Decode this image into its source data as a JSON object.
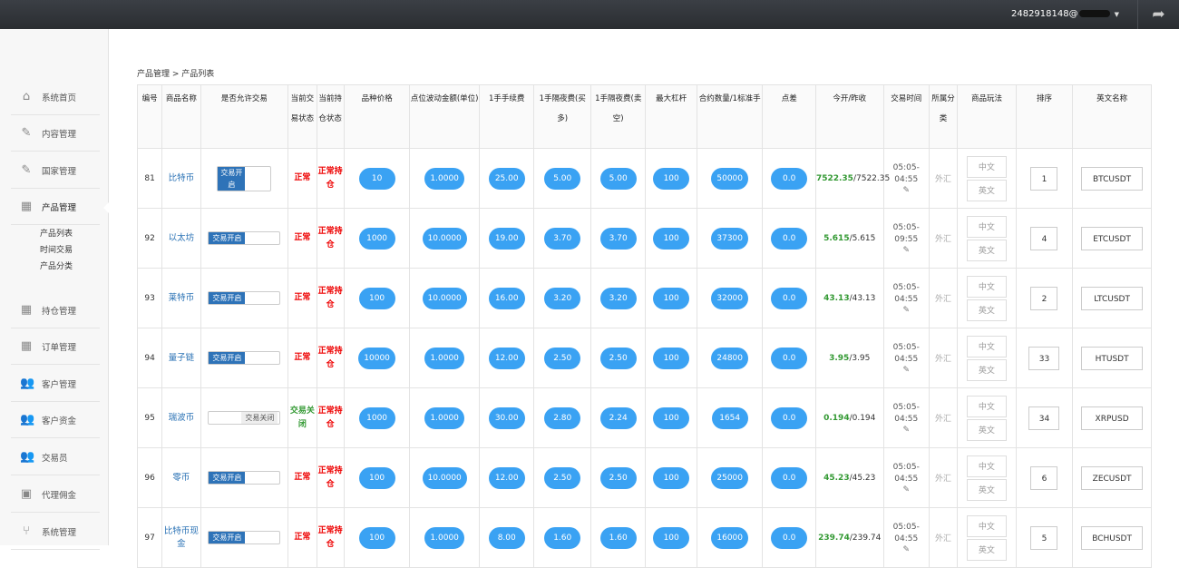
{
  "topbar": {
    "user": "2482918148@"
  },
  "sidebar": {
    "items": [
      {
        "label": "系统首页",
        "icon": "home-icon"
      },
      {
        "label": "内容管理",
        "icon": "edit-icon"
      },
      {
        "label": "国家管理",
        "icon": "edit-icon"
      },
      {
        "label": "产品管理",
        "icon": "calendar-icon"
      },
      {
        "label": "持仓管理",
        "icon": "grid-icon"
      },
      {
        "label": "订单管理",
        "icon": "grid-icon"
      },
      {
        "label": "客户管理",
        "icon": "users-icon"
      },
      {
        "label": "客户资金",
        "icon": "users-icon"
      },
      {
        "label": "交易员",
        "icon": "users-icon"
      },
      {
        "label": "代理佣金",
        "icon": "image-icon"
      },
      {
        "label": "系统管理",
        "icon": "branch-icon"
      }
    ],
    "sub": [
      "产品列表",
      "时间交易",
      "产品分类"
    ]
  },
  "breadcrumb": "产品管理 > 产品列表",
  "table": {
    "headers": [
      "编号",
      "商品名称",
      "是否允许交易",
      "当前交易状态",
      "当前持仓状态",
      "品种价格",
      "点位波动金额(单位)",
      "1手手续费",
      "1手隔夜费(买多)",
      "1手隔夜费(卖空)",
      "最大杠杆",
      "合约数量/1标准手",
      "点差",
      "今开/昨收",
      "交易时间",
      "所属分类",
      "商品玩法",
      "排序",
      "英文名称"
    ],
    "rows": [
      {
        "id": "81",
        "name": "比特币",
        "toggle": "交易开启",
        "tstate": "正常",
        "hstate": "正常持仓",
        "price": "10",
        "wave": "1.0000",
        "fee": "25.00",
        "buy": "5.00",
        "sell": "5.00",
        "lev": "100",
        "qty": "50000",
        "spread": "0.0",
        "open": "7522.35",
        "close": "/7522.35",
        "time": "05:05-04:55",
        "cat": "外汇",
        "zh": "中文",
        "en": "英文",
        "sort": "1",
        "eng": "BTCUSDT"
      },
      {
        "id": "92",
        "name": "以太坊",
        "toggle": "交易开启",
        "tstate": "正常",
        "hstate": "正常持仓",
        "price": "1000",
        "wave": "10.0000",
        "fee": "19.00",
        "buy": "3.70",
        "sell": "3.70",
        "lev": "100",
        "qty": "37300",
        "spread": "0.0",
        "open": "5.615",
        "close": "/5.615",
        "time": "05:05-09:55",
        "cat": "外汇",
        "zh": "中文",
        "en": "英文",
        "sort": "4",
        "eng": "ETCUSDT"
      },
      {
        "id": "93",
        "name": "莱特币",
        "toggle": "交易开启",
        "tstate": "正常",
        "hstate": "正常持仓",
        "price": "100",
        "wave": "10.0000",
        "fee": "16.00",
        "buy": "3.20",
        "sell": "3.20",
        "lev": "100",
        "qty": "32000",
        "spread": "0.0",
        "open": "43.13",
        "close": "/43.13",
        "time": "05:05-04:55",
        "cat": "外汇",
        "zh": "中文",
        "en": "英文",
        "sort": "2",
        "eng": "LTCUSDT"
      },
      {
        "id": "94",
        "name": "量子链",
        "toggle": "交易开启",
        "tstate": "正常",
        "hstate": "正常持仓",
        "price": "10000",
        "wave": "1.0000",
        "fee": "12.00",
        "buy": "2.50",
        "sell": "2.50",
        "lev": "100",
        "qty": "24800",
        "spread": "0.0",
        "open": "3.95",
        "close": "/3.95",
        "time": "05:05-04:55",
        "cat": "外汇",
        "zh": "中文",
        "en": "英文",
        "sort": "33",
        "eng": "HTUSDT"
      },
      {
        "id": "95",
        "name": "瑞波币",
        "toggle": "交易关闭",
        "tstate": "交易关闭",
        "hstate": "正常持仓",
        "price": "1000",
        "wave": "1.0000",
        "fee": "30.00",
        "buy": "2.80",
        "sell": "2.24",
        "lev": "100",
        "qty": "1654",
        "spread": "0.0",
        "open": "0.194",
        "close": "/0.194",
        "time": "05:05-04:55",
        "cat": "外汇",
        "zh": "中文",
        "en": "英文",
        "sort": "34",
        "eng": "XRPUSD"
      },
      {
        "id": "96",
        "name": "零币",
        "toggle": "交易开启",
        "tstate": "正常",
        "hstate": "正常持仓",
        "price": "100",
        "wave": "10.0000",
        "fee": "12.00",
        "buy": "2.50",
        "sell": "2.50",
        "lev": "100",
        "qty": "25000",
        "spread": "0.0",
        "open": "45.23",
        "close": "/45.23",
        "time": "05:05-04:55",
        "cat": "外汇",
        "zh": "中文",
        "en": "英文",
        "sort": "6",
        "eng": "ZECUSDT"
      },
      {
        "id": "97",
        "name": "比特币现金",
        "toggle": "交易开启",
        "tstate": "正常",
        "hstate": "正常持仓",
        "price": "100",
        "wave": "1.0000",
        "fee": "8.00",
        "buy": "1.60",
        "sell": "1.60",
        "lev": "100",
        "qty": "16000",
        "spread": "0.0",
        "open": "239.74",
        "close": "/239.74",
        "time": "05:05-04:55",
        "cat": "外汇",
        "zh": "中文",
        "en": "英文",
        "sort": "5",
        "eng": "BCHUSDT"
      }
    ]
  }
}
